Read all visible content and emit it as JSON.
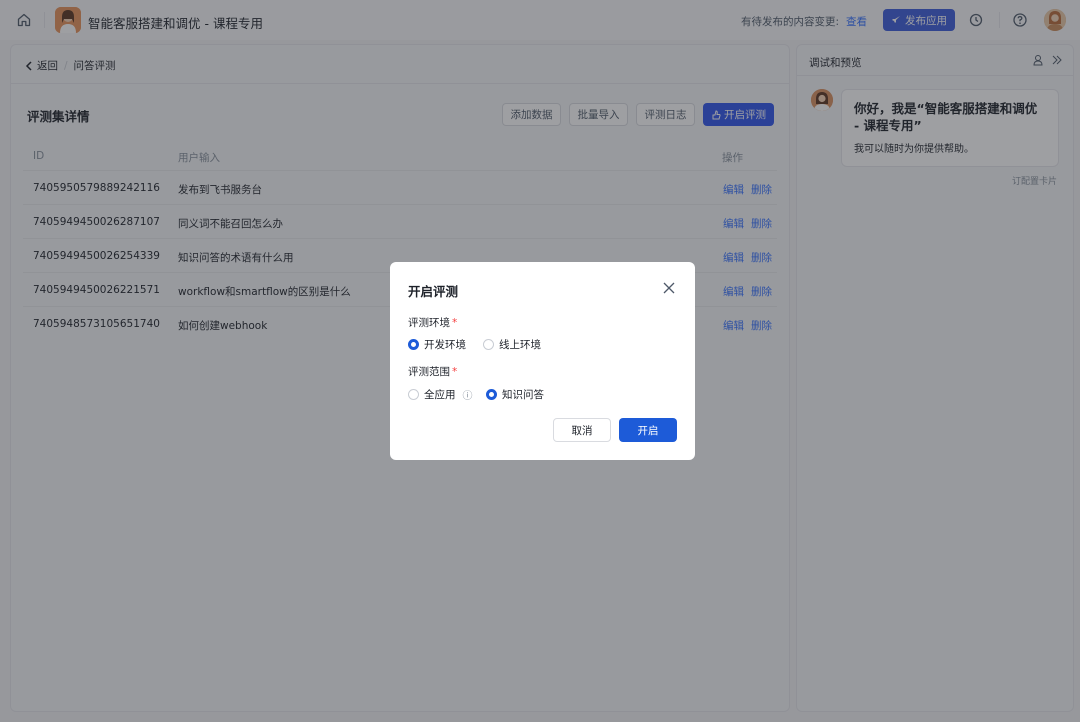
{
  "topbar": {
    "app_title": "智能客服搭建和调优 - 课程专用",
    "pending_text": "有待发布的内容变更:",
    "view_link": "查看",
    "publish_label": "发布应用"
  },
  "breadcrumb": {
    "back": "返回",
    "current": "问答评测"
  },
  "section": {
    "title": "评测集详情",
    "add_data": "添加数据",
    "batch_import": "批量导入",
    "eval_log": "评测日志",
    "start_eval": "开启评测"
  },
  "table": {
    "columns": [
      "ID",
      "用户输入",
      "操作"
    ],
    "rows": [
      {
        "id": "7405950579889242116",
        "input": "发布到飞书服务台",
        "edit": "编辑",
        "delete": "删除"
      },
      {
        "id": "7405949450026287107",
        "input": "同义词不能召回怎么办",
        "edit": "编辑",
        "delete": "删除"
      },
      {
        "id": "7405949450026254339",
        "input": "知识问答的术语有什么用",
        "edit": "编辑",
        "delete": "删除"
      },
      {
        "id": "7405949450026221571",
        "input": "workflow和smartflow的区别是什么",
        "edit": "编辑",
        "delete": "删除"
      },
      {
        "id": "7405948573105651740",
        "input": "如何创建webhook",
        "edit": "编辑",
        "delete": "删除"
      }
    ]
  },
  "preview": {
    "title": "调试和预览",
    "greeting": "你好，我是“智能客服搭建和调优 - 课程专用”",
    "subtext": "我可以随时为你提供帮助。",
    "config_card": "订配置卡片"
  },
  "modal": {
    "title": "开启评测",
    "env_label": "评测环境",
    "env_options": [
      "开发环境",
      "线上环境"
    ],
    "env_selected": "开发环境",
    "scope_label": "评测范围",
    "scope_options": [
      "全应用",
      "知识问答"
    ],
    "scope_selected": "知识问答",
    "cancel": "取消",
    "confirm": "开启",
    "required_mark": "*",
    "info_glyph": "ⓘ"
  },
  "colors": {
    "primary": "#1d5bd8",
    "link": "#3370ff",
    "required": "#f53f3f"
  }
}
